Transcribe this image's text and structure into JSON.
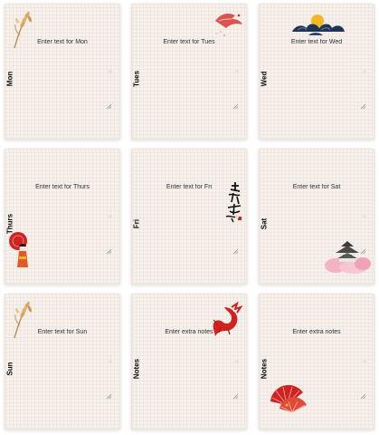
{
  "cards": [
    {
      "day": "Mon",
      "prompt": "Enter text for Mon",
      "deco": "wheat-icon"
    },
    {
      "day": "Tues",
      "prompt": "Enter text for Tues",
      "deco": "crane-icon"
    },
    {
      "day": "Wed",
      "prompt": "Enter text for Wed",
      "deco": "sun-clouds-icon"
    },
    {
      "day": "Thurs",
      "prompt": "Enter text for Thurs",
      "deco": "geisha-icon"
    },
    {
      "day": "Fri",
      "prompt": "Enter text for Fri",
      "deco": "calligraphy-icon"
    },
    {
      "day": "Sat",
      "prompt": "Enter text for Sat",
      "deco": "castle-icon"
    },
    {
      "day": "Sun",
      "prompt": "Enter text for Sun",
      "deco": "wheat-icon"
    },
    {
      "day": "Notes",
      "prompt": "Enter extra notes",
      "deco": "dragon-icon"
    },
    {
      "day": "Notes",
      "prompt": "Enter extra notes",
      "deco": "fans-icon"
    }
  ],
  "colors": {
    "card_background": "#f6f1ec",
    "accent_red": "#d0231f",
    "sun_gold": "#f2b824",
    "cloud_navy": "#1f3354",
    "blossom_pink": "#f2b3c3"
  }
}
